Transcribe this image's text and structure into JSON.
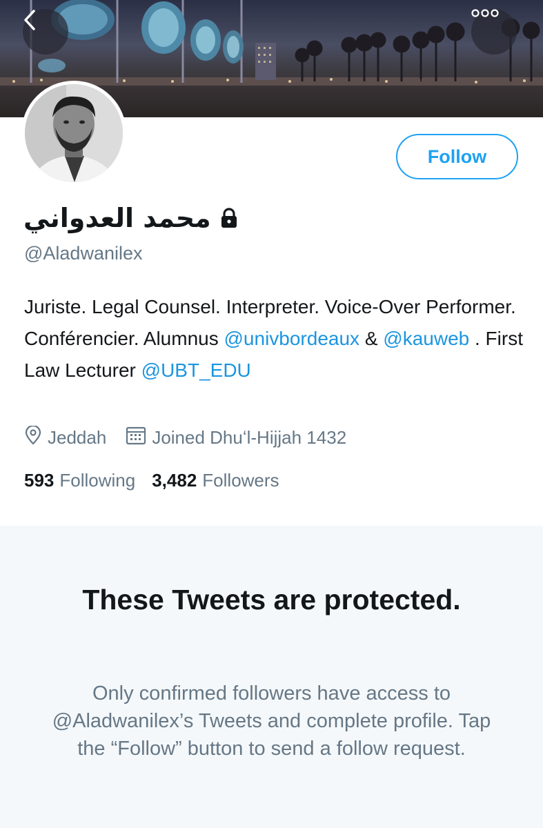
{
  "header": {
    "back_icon": "chevron-left-icon",
    "more_icon": "more-horizontal-icon"
  },
  "profile": {
    "display_name": "محمد العدواني",
    "protected_icon": "lock-icon",
    "handle": "@Aladwanilex",
    "follow_label": "Follow",
    "bio": {
      "text_1": "Juriste. Legal Counsel. Interpreter. Voice-Over Performer. Conférencier. Alumnus ",
      "mention_1": "@univbordeaux",
      "text_2": " & ",
      "mention_2": "@kauweb",
      "text_3": " . First Law Lecturer ",
      "mention_3": "@UBT_EDU"
    },
    "location": "Jeddah",
    "joined": "Joined Dhuʻl-Hijjah 1432",
    "following_count": "593",
    "following_label": "Following",
    "followers_count": "3,482",
    "followers_label": "Followers"
  },
  "protected_notice": {
    "title": "These Tweets are protected.",
    "message": "Only confirmed followers have access to @Aladwanilex’s Tweets and complete profile. Tap the “Follow” button to send a follow request."
  },
  "colors": {
    "accent": "#1da1f2",
    "link": "#1b95e0",
    "secondary_text": "#657786",
    "panel_bg": "#f5f8fa"
  }
}
